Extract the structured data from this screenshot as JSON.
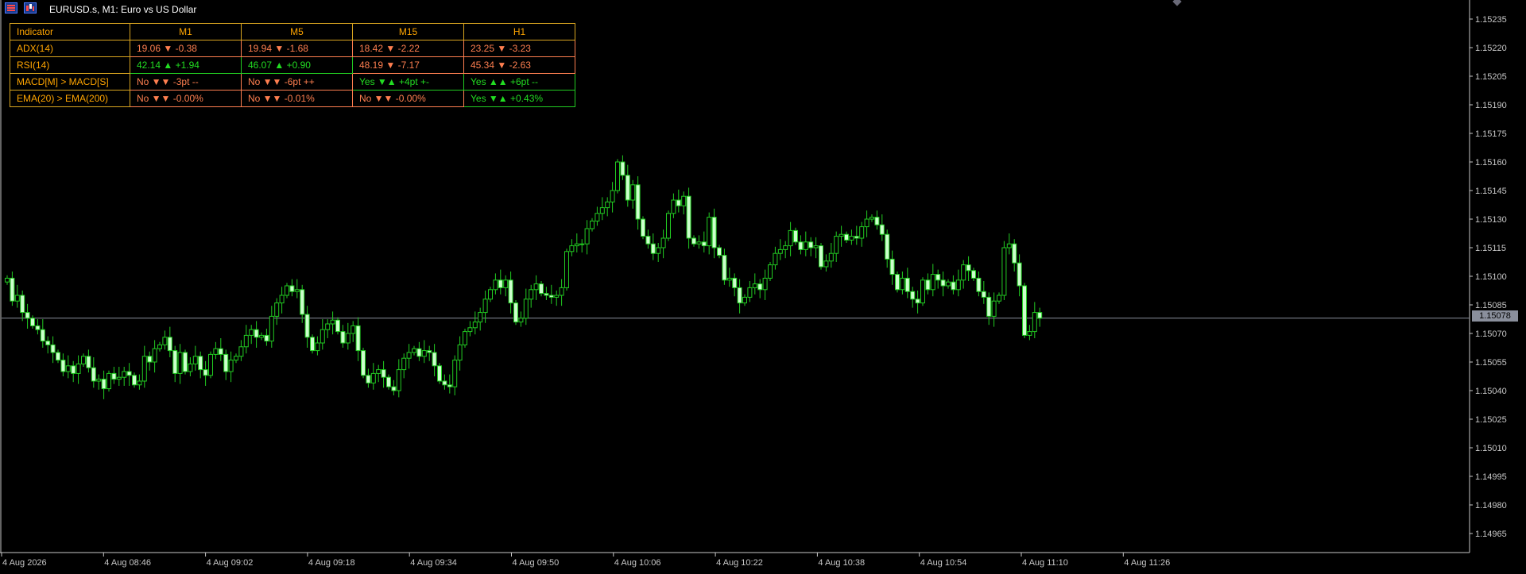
{
  "window": {
    "title": "EURUSD.s, M1:  Euro vs US Dollar"
  },
  "table": {
    "headers": [
      "Indicator",
      "M1",
      "M5",
      "M15",
      "H1"
    ],
    "rows": [
      {
        "label": "ADX(14)",
        "cells": [
          {
            "text": "19.06 ▼ -0.38",
            "status": "red"
          },
          {
            "text": "19.94 ▼ -1.68",
            "status": "red"
          },
          {
            "text": "18.42 ▼ -2.22",
            "status": "red"
          },
          {
            "text": "23.25 ▼ -3.23",
            "status": "red"
          }
        ]
      },
      {
        "label": "RSI(14)",
        "cells": [
          {
            "text": "42.14 ▲ +1.94",
            "status": "green"
          },
          {
            "text": "46.07 ▲ +0.90",
            "status": "green"
          },
          {
            "text": "48.19 ▼ -7.17",
            "status": "red"
          },
          {
            "text": "45.34 ▼ -2.63",
            "status": "red"
          }
        ]
      },
      {
        "label": "MACD[M] > MACD[S]",
        "cells": [
          {
            "text": "No  ▼▼ -3pt  --",
            "status": "red"
          },
          {
            "text": "No  ▼▼ -6pt  ++",
            "status": "red"
          },
          {
            "text": "Yes ▼▲ +4pt  +-",
            "status": "green"
          },
          {
            "text": "Yes ▲▲ +6pt  --",
            "status": "green"
          }
        ]
      },
      {
        "label": "EMA(20) > EMA(200)",
        "cells": [
          {
            "text": "No  ▼▼ -0.00%",
            "status": "red"
          },
          {
            "text": "No  ▼▼ -0.01%",
            "status": "red"
          },
          {
            "text": "No  ▼▼ -0.00%",
            "status": "red"
          },
          {
            "text": "Yes ▼▲ +0.43%",
            "status": "green"
          }
        ]
      }
    ]
  },
  "colors": {
    "bull": "#ccffcc",
    "bear": "#ffffff",
    "wick": "#22cc22",
    "background": "#000000",
    "red": "#ff7f50",
    "green": "#22dd22"
  },
  "price_axis": {
    "labels": [
      "1.15235",
      "1.15220",
      "1.15205",
      "1.15190",
      "1.15175",
      "1.15160",
      "1.15145",
      "1.15130",
      "1.15115",
      "1.15100",
      "1.15085",
      "1.15070",
      "1.15055",
      "1.15040",
      "1.15025",
      "1.15010",
      "1.14995",
      "1.14980",
      "1.14965"
    ],
    "current_price": "1.15078"
  },
  "time_axis": {
    "labels": [
      "4 Aug 2026",
      "4 Aug 08:46",
      "4 Aug 09:02",
      "4 Aug 09:18",
      "4 Aug 09:34",
      "4 Aug 09:50",
      "4 Aug 10:06",
      "4 Aug 10:22",
      "4 Aug 10:38",
      "4 Aug 10:54",
      "4 Aug 11:10",
      "4 Aug 11:26"
    ]
  },
  "chart_data": {
    "type": "candlestick",
    "symbol": "EURUSD.s",
    "timeframe": "M1",
    "ylim": [
      1.14955,
      1.15245
    ],
    "current_price": 1.15078,
    "closes": [
      1.15099,
      1.15087,
      1.1509,
      1.15081,
      1.15078,
      1.15074,
      1.15072,
      1.15066,
      1.15064,
      1.1506,
      1.15056,
      1.1505,
      1.15053,
      1.15049,
      1.15054,
      1.15058,
      1.15052,
      1.15045,
      1.15046,
      1.15041,
      1.15049,
      1.15046,
      1.15047,
      1.1505,
      1.15048,
      1.15043,
      1.15045,
      1.15058,
      1.15055,
      1.15062,
      1.15064,
      1.15068,
      1.15061,
      1.15049,
      1.1506,
      1.1505,
      1.15054,
      1.15058,
      1.15051,
      1.15048,
      1.15059,
      1.15062,
      1.15059,
      1.1505,
      1.15056,
      1.15058,
      1.15063,
      1.15069,
      1.15072,
      1.15068,
      1.15069,
      1.15066,
      1.15079,
      1.15086,
      1.1509,
      1.15095,
      1.15092,
      1.15093,
      1.1508,
      1.15068,
      1.15061,
      1.15065,
      1.15072,
      1.15075,
      1.15077,
      1.15071,
      1.15065,
      1.1507,
      1.15074,
      1.15061,
      1.15048,
      1.15044,
      1.15049,
      1.15051,
      1.15047,
      1.15042,
      1.1504,
      1.15051,
      1.15057,
      1.1506,
      1.15062,
      1.15058,
      1.15061,
      1.1506,
      1.15053,
      1.15045,
      1.15043,
      1.15042,
      1.15056,
      1.15064,
      1.15071,
      1.15073,
      1.15076,
      1.15081,
      1.15088,
      1.15093,
      1.15098,
      1.15094,
      1.15098,
      1.15086,
      1.15076,
      1.15078,
      1.15088,
      1.15093,
      1.15096,
      1.15091,
      1.1509,
      1.15089,
      1.1509,
      1.15094,
      1.15113,
      1.15116,
      1.15117,
      1.15117,
      1.15125,
      1.15129,
      1.15133,
      1.15136,
      1.15139,
      1.15145,
      1.1516,
      1.15153,
      1.1514,
      1.15148,
      1.1513,
      1.15121,
      1.15117,
      1.15112,
      1.15115,
      1.1512,
      1.15133,
      1.1514,
      1.15137,
      1.15142,
      1.1512,
      1.15117,
      1.15118,
      1.15116,
      1.15131,
      1.15115,
      1.15111,
      1.15098,
      1.15099,
      1.15094,
      1.15086,
      1.15089,
      1.15094,
      1.15096,
      1.15093,
      1.15099,
      1.15106,
      1.15112,
      1.15114,
      1.15116,
      1.15124,
      1.15118,
      1.15114,
      1.15118,
      1.15115,
      1.15116,
      1.15105,
      1.15108,
      1.15112,
      1.15121,
      1.15122,
      1.15119,
      1.15121,
      1.1512,
      1.15126,
      1.1513,
      1.15131,
      1.15127,
      1.15122,
      1.15109,
      1.15101,
      1.15093,
      1.15099,
      1.15092,
      1.15088,
      1.15086,
      1.15098,
      1.15093,
      1.15101,
      1.15098,
      1.15095,
      1.15097,
      1.15093,
      1.15098,
      1.15106,
      1.15103,
      1.15099,
      1.15092,
      1.15089,
      1.15079,
      1.15087,
      1.1509,
      1.15115,
      1.15117,
      1.15107,
      1.15095,
      1.15069,
      1.15071,
      1.15081,
      1.15078
    ]
  }
}
